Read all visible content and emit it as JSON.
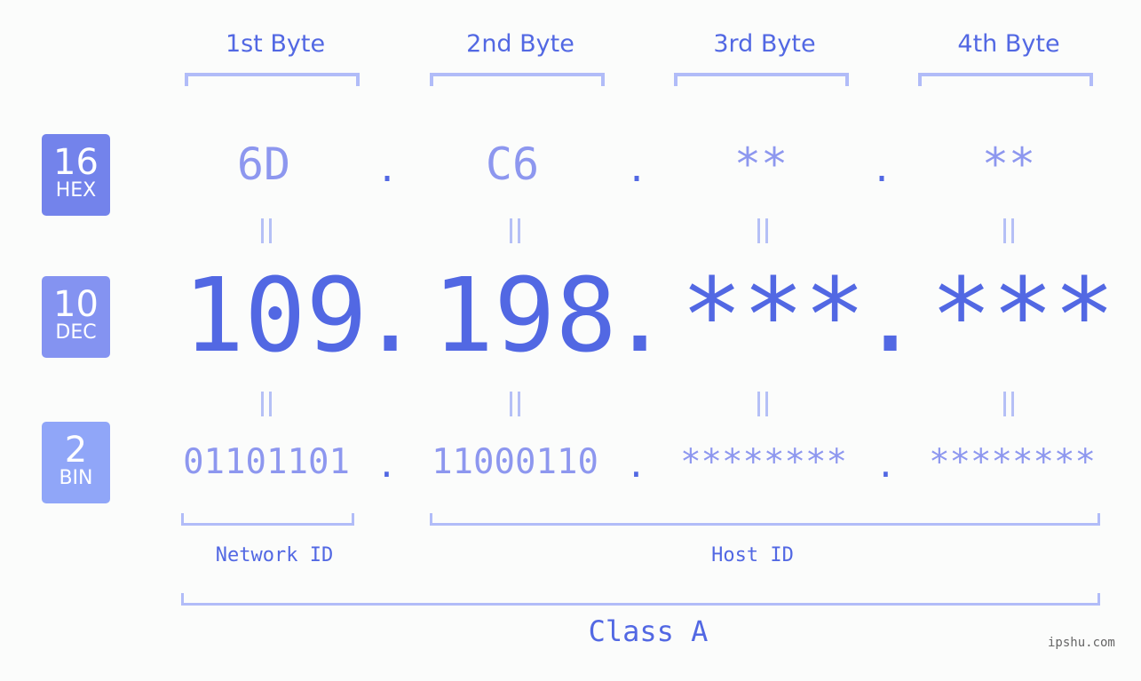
{
  "bytes": [
    {
      "label": "1st Byte",
      "hex": "6D",
      "dec": "109",
      "bin": "01101101"
    },
    {
      "label": "2nd Byte",
      "hex": "C6",
      "dec": "198",
      "bin": "11000110"
    },
    {
      "label": "3rd Byte",
      "hex": "**",
      "dec": "***",
      "bin": "********"
    },
    {
      "label": "4th Byte",
      "hex": "**",
      "dec": "***",
      "bin": "********"
    }
  ],
  "bases": [
    {
      "num": "16",
      "name": "HEX",
      "color": "#7383eb"
    },
    {
      "num": "10",
      "name": "DEC",
      "color": "#8493f1"
    },
    {
      "num": "2",
      "name": "BIN",
      "color": "#90a6f8"
    }
  ],
  "separator": ".",
  "network_label": "Network ID",
  "host_label": "Host ID",
  "class_label": "Class A",
  "watermark": "ipshu.com",
  "colors": {
    "primary": "#5268e3",
    "secondary": "#8d97ef",
    "bracket": "#b1bcf8"
  }
}
